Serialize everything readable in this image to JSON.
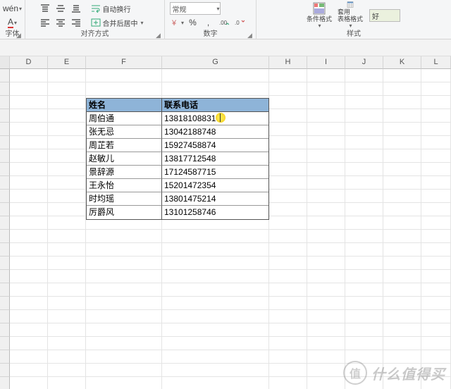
{
  "ribbon": {
    "font": {
      "label": "字体",
      "wen_btn": "wén",
      "a_btn": "A"
    },
    "align": {
      "label": "对齐方式",
      "wrap_text": "自动换行",
      "merge_center": "合并后居中"
    },
    "number": {
      "label": "数字",
      "format_combo": "常规",
      "pct": "%",
      "comma": ","
    },
    "style": {
      "label": "样式",
      "cond_fmt": "条件格式",
      "table_fmt": "套用\n表格格式",
      "good": "好"
    }
  },
  "columns": [
    "D",
    "E",
    "F",
    "G",
    "H",
    "I",
    "J",
    "K",
    "L"
  ],
  "table": {
    "headers": {
      "name": "姓名",
      "phone": "联系电话"
    },
    "rows": [
      {
        "name": "周伯通",
        "phone": "13818108831"
      },
      {
        "name": "张无忌",
        "phone": "13042188748"
      },
      {
        "name": "周芷若",
        "phone": "15927458874"
      },
      {
        "name": "赵敏儿",
        "phone": "13817712548"
      },
      {
        "name": "景辞源",
        "phone": "17124587715"
      },
      {
        "name": "王永怡",
        "phone": "15201472354"
      },
      {
        "name": "时均瑶",
        "phone": "13801475214"
      },
      {
        "name": "厉爵风",
        "phone": "13101258746"
      }
    ]
  },
  "watermark": {
    "badge": "值",
    "text": "什么值得买"
  }
}
